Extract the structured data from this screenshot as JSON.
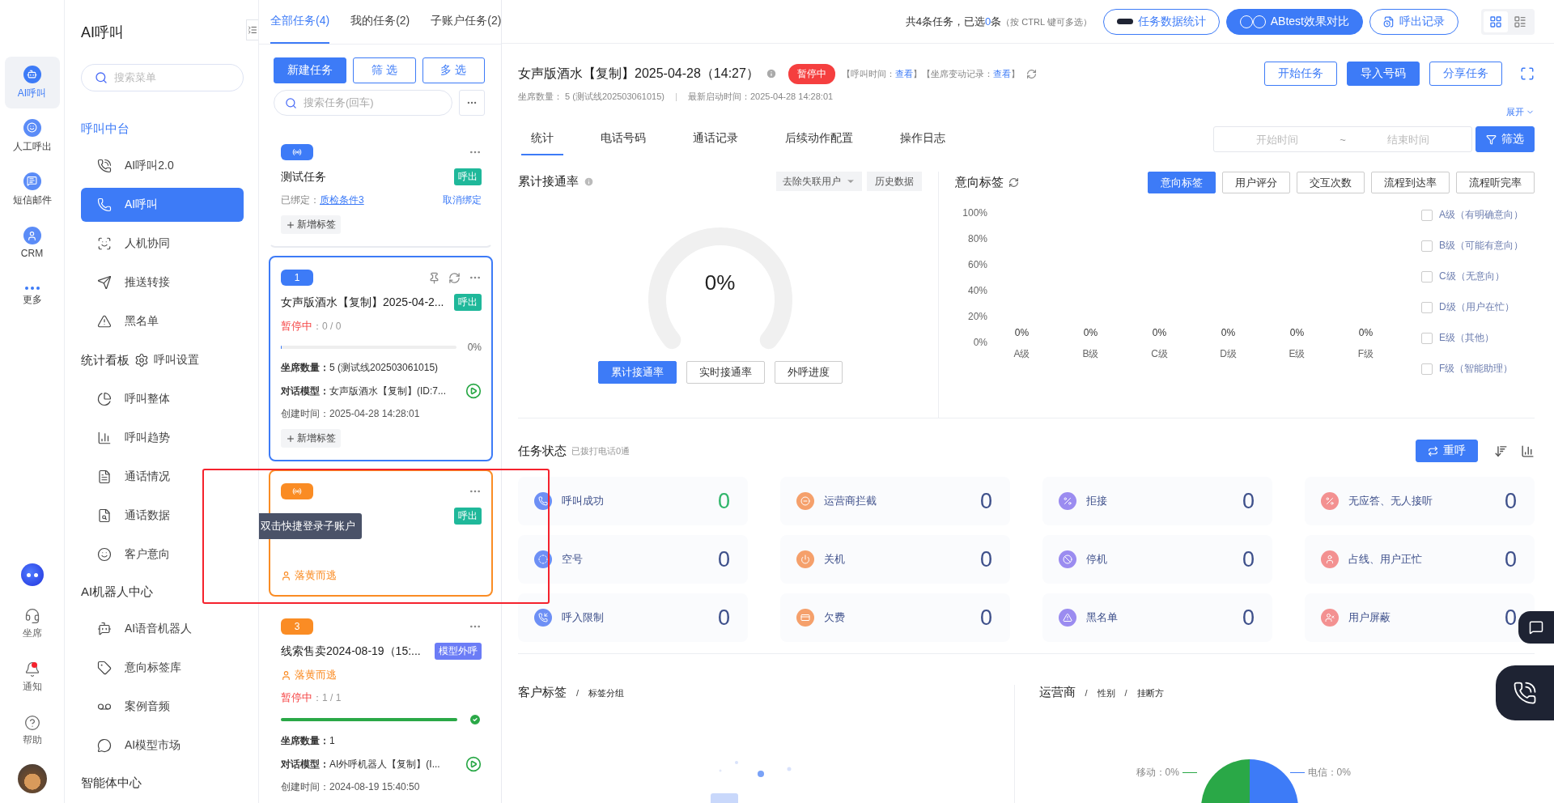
{
  "rail": {
    "items": [
      {
        "label": "AI呼叫",
        "selected": true
      },
      {
        "label": "人工呼出",
        "selected": false
      },
      {
        "label": "短信邮件",
        "selected": false
      },
      {
        "label": "CRM",
        "selected": false
      },
      {
        "label": "更多",
        "selected": false
      }
    ],
    "bottom_items": [
      {
        "label": "坐席",
        "badge": false
      },
      {
        "label": "通知",
        "badge": true
      },
      {
        "label": "帮助",
        "badge": false
      }
    ]
  },
  "menu": {
    "title": "AI呼叫",
    "search_placeholder": "搜索菜单",
    "groups": [
      {
        "heading": "呼叫中台",
        "items": [
          {
            "label": "AI呼叫2.0",
            "selected": false
          },
          {
            "label": "AI呼叫",
            "selected": true
          },
          {
            "label": "人机协同",
            "selected": false
          },
          {
            "label": "推送转接",
            "selected": false
          },
          {
            "label": "黑名单",
            "selected": false
          }
        ]
      },
      {
        "heading": "统计看板",
        "heading_item": {
          "label": "呼叫设置",
          "selected": false
        },
        "items": [
          {
            "label": "呼叫整体",
            "selected": false
          },
          {
            "label": "呼叫趋势",
            "selected": false
          },
          {
            "label": "通话情况",
            "selected": false
          },
          {
            "label": "通话数据",
            "selected": false
          },
          {
            "label": "客户意向",
            "selected": false
          }
        ]
      },
      {
        "heading": "AI机器人中心",
        "items": [
          {
            "label": "AI语音机器人",
            "selected": false
          },
          {
            "label": "意向标签库",
            "selected": false
          },
          {
            "label": "案例音频",
            "selected": false
          },
          {
            "label": "AI模型市场",
            "selected": false
          }
        ]
      },
      {
        "heading": "智能体中心"
      }
    ]
  },
  "task_list": {
    "tabs": [
      {
        "label": "全部任务(4)",
        "selected": true
      },
      {
        "label": "我的任务(2)",
        "selected": false
      },
      {
        "label": "子账户任务(2)",
        "selected": false
      }
    ],
    "buttons": [
      {
        "label": "新建任务",
        "kind": "primary"
      },
      {
        "label": "筛 选",
        "kind": "outline"
      },
      {
        "label": "多 选",
        "kind": "outline"
      }
    ],
    "search_placeholder": "搜索任务(回车)",
    "tasks": [
      {
        "badge": {
          "kind": "icon",
          "color": "#3d7bf7"
        },
        "selected": false,
        "hovered": false,
        "title": "测试任务",
        "tag": {
          "text": "呼出",
          "color": "#1fb89a"
        },
        "binding": {
          "label": "已绑定：",
          "link": "质检条件3",
          "action": "取消绑定"
        },
        "add_tag": "新增标签"
      },
      {
        "badge": {
          "kind": "number",
          "text": "1",
          "color": "#3d7bf7"
        },
        "selected": true,
        "hovered": false,
        "tools": [
          {
            "kind": "pin"
          },
          {
            "kind": "refresh"
          }
        ],
        "title": "女声版酒水【复制】2025-04-2...",
        "tag": {
          "text": "呼出",
          "color": "#1fb89a"
        },
        "status": {
          "label": "暂停中",
          "count": "：0 / 0"
        },
        "progress": {
          "level": 0,
          "reading": "0%",
          "complete": false
        },
        "seats": {
          "label": "坐席数量：",
          "value": "5 (测试线202503061015)"
        },
        "model": {
          "label": "对话模型：",
          "value": "女声版酒水【复制】(ID:7..."
        },
        "created": {
          "label": "创建时间：",
          "value": "2025-04-28 14:28:01"
        },
        "add_tag": "新增标签"
      },
      {
        "badge": {
          "kind": "icon",
          "color": "#fa8c24"
        },
        "selected": false,
        "hovered": true,
        "tag": {
          "text": "呼出",
          "color": "#1fb89a"
        },
        "owner": "落黄而逃",
        "tooltip": "双击快捷登录子账户"
      },
      {
        "badge": {
          "kind": "number",
          "text": "3",
          "color": "#fa8c24"
        },
        "selected": false,
        "hovered": false,
        "title": "线索售卖2024-08-19（15:...",
        "tag": {
          "text": "模型外呼",
          "color": "#6b7cf6"
        },
        "owner": "落黄而逃",
        "status": {
          "label": "暂停中",
          "count": "：1 / 1"
        },
        "progress": {
          "level": 1,
          "complete": true
        },
        "seats": {
          "label": "坐席数量：",
          "value": "1"
        },
        "model": {
          "label": "对话模型：",
          "value": "AI外呼机器人【复制】(I..."
        },
        "created": {
          "label": "创建时间：",
          "value": "2024-08-19 15:40:50"
        }
      }
    ]
  },
  "toolbar": {
    "summary_prefix": "共4条任务，已选",
    "selected_count": "0",
    "summary_suffix": "条",
    "hint": "（按 CTRL 键可多选）",
    "buttons": [
      {
        "label": "任务数据统计",
        "kind": "outline"
      },
      {
        "label": "ABtest效果对比",
        "kind": "primary"
      },
      {
        "label": "呼出记录",
        "kind": "outline"
      }
    ],
    "views": [
      {
        "kind": "grid",
        "selected": true
      },
      {
        "kind": "list",
        "selected": false
      }
    ]
  },
  "task": {
    "title": "女声版酒水【复制】2025-04-28（14:27）",
    "status": "暂停中",
    "meta": [
      {
        "text": "【呼叫时间："
      },
      {
        "link": "查看"
      },
      {
        "text": "】【坐席变动记录："
      },
      {
        "link": "查看"
      },
      {
        "text": "】"
      }
    ],
    "seats": "坐席数量： 5 (测试线202503061015)",
    "last_start": "最新启动时间：2025-04-28 14:28:01",
    "actions": [
      {
        "label": "开始任务",
        "kind": "outline"
      },
      {
        "label": "导入号码",
        "kind": "primary"
      },
      {
        "label": "分享任务",
        "kind": "outline"
      }
    ],
    "expand": "展开"
  },
  "tabs": [
    {
      "label": "统计",
      "selected": true
    },
    {
      "label": "电话号码",
      "selected": false
    },
    {
      "label": "通话记录",
      "selected": false
    },
    {
      "label": "后续动作配置",
      "selected": false
    },
    {
      "label": "操作日志",
      "selected": false
    }
  ],
  "date_range": {
    "start_placeholder": "开始时间",
    "separator": "~",
    "end_placeholder": "结束时间",
    "button": "筛选"
  },
  "rate": {
    "title": "累计接通率",
    "dropdown": "去除失联用户",
    "history": "历史数据",
    "reading": "0%",
    "modes": [
      {
        "label": "累计接通率",
        "selected": true
      },
      {
        "label": "实时接通率",
        "selected": false
      },
      {
        "label": "外呼进度",
        "selected": false
      }
    ]
  },
  "intent": {
    "title": "意向标签",
    "tabs": [
      {
        "label": "意向标签",
        "selected": true
      },
      {
        "label": "用户评分",
        "selected": false
      },
      {
        "label": "交互次数",
        "selected": false
      },
      {
        "label": "流程到达率",
        "selected": false
      },
      {
        "label": "流程听完率",
        "selected": false
      }
    ],
    "chart_data": {
      "type": "bar",
      "categories": [
        "A级",
        "B级",
        "C级",
        "D级",
        "E级",
        "F级"
      ],
      "values": [
        0,
        0,
        0,
        0,
        0,
        0
      ],
      "ylim": [
        0,
        100
      ],
      "yticks": [
        {
          "value": 0,
          "label": "0%"
        },
        {
          "value": 20,
          "label": "20%"
        },
        {
          "value": 40,
          "label": "40%"
        },
        {
          "value": 60,
          "label": "60%"
        },
        {
          "value": 80,
          "label": "80%"
        },
        {
          "value": 100,
          "label": "100%"
        }
      ],
      "value_labels": [
        "0%",
        "0%",
        "0%",
        "0%",
        "0%",
        "0%"
      ]
    },
    "legend": [
      {
        "label": "A级（有明确意向）",
        "checked": false
      },
      {
        "label": "B级（可能有意向）",
        "checked": false
      },
      {
        "label": "C级（无意向）",
        "checked": false
      },
      {
        "label": "D级（用户在忙）",
        "checked": false
      },
      {
        "label": "E级（其他）",
        "checked": false
      },
      {
        "label": "F级（智能助理）",
        "checked": false
      }
    ]
  },
  "status": {
    "title": "任务状态",
    "subtitle": "已拨打电话0通",
    "recall": "重呼",
    "items": [
      {
        "label": "呼叫成功",
        "count": "0",
        "color": "#6d8ff5",
        "success": true
      },
      {
        "label": "运营商拦截",
        "count": "0",
        "color": "#f5a06b",
        "success": false
      },
      {
        "label": "拒接",
        "count": "0",
        "color": "#9b8cf0",
        "success": false
      },
      {
        "label": "无应答、无人接听",
        "count": "0",
        "color": "#f39191",
        "success": false
      },
      {
        "label": "空号",
        "count": "0",
        "color": "#6d8ff5",
        "success": false
      },
      {
        "label": "关机",
        "count": "0",
        "color": "#f5a06b",
        "success": false
      },
      {
        "label": "停机",
        "count": "0",
        "color": "#9b8cf0",
        "success": false
      },
      {
        "label": "占线、用户正忙",
        "count": "0",
        "color": "#f39191",
        "success": false
      },
      {
        "label": "呼入限制",
        "count": "0",
        "color": "#6d8ff5",
        "success": false
      },
      {
        "label": "欠费",
        "count": "0",
        "color": "#f5a06b",
        "success": false
      },
      {
        "label": "黑名单",
        "count": "0",
        "color": "#9b8cf0",
        "success": false
      },
      {
        "label": "用户屏蔽",
        "count": "0",
        "color": "#f39191",
        "success": false
      }
    ]
  },
  "customer_tags": {
    "tabs": [
      {
        "label": "客户标签",
        "selected": true
      },
      {
        "label": "标签分组",
        "selected": false
      }
    ],
    "separators": [
      "/"
    ]
  },
  "carrier": {
    "tabs": [
      {
        "label": "运营商",
        "selected": true
      },
      {
        "label": "性别",
        "selected": false
      },
      {
        "label": "挂断方",
        "selected": false
      }
    ],
    "separators": [
      "/",
      "/"
    ],
    "pie_labels": [
      {
        "text": "移动：0%",
        "color": "#2aa847"
      },
      {
        "text": "电信：0%",
        "color": "#3d7bf7"
      }
    ]
  }
}
